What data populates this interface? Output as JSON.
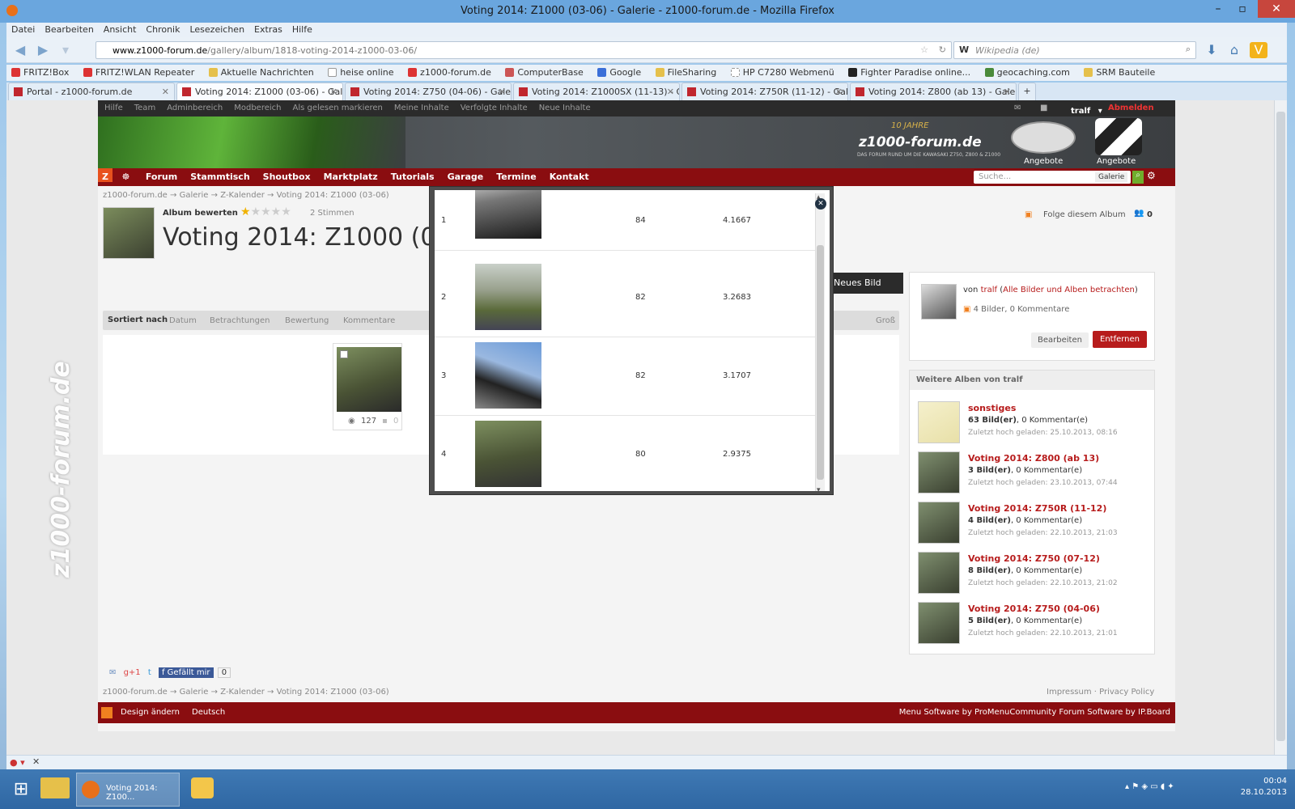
{
  "window": {
    "title": "Voting 2014: Z1000 (03-06) - Galerie - z1000-forum.de - Mozilla Firefox"
  },
  "menu": [
    "Datei",
    "Bearbeiten",
    "Ansicht",
    "Chronik",
    "Lesezeichen",
    "Extras",
    "Hilfe"
  ],
  "url": {
    "domain": "www.z1000-forum.de",
    "path": "/gallery/album/1818-voting-2014-z1000-03-06/"
  },
  "search_placeholder": "Wikipedia (de)",
  "bookmarks": [
    "FRITZ!Box",
    "FRITZ!WLAN Repeater",
    "Aktuelle Nachrichten",
    "heise online",
    "z1000-forum.de",
    "ComputerBase",
    "Google",
    "FileSharing",
    "HP C7280 Webmenü",
    "Fighter Paradise online...",
    "geocaching.com",
    "SRM Bauteile"
  ],
  "tabs": [
    {
      "label": "Portal - z1000-forum.de"
    },
    {
      "label": "Voting 2014: Z1000 (03-06) - Galerie - ..."
    },
    {
      "label": "Voting 2014: Z750 (04-06) - Galerie - z..."
    },
    {
      "label": "Voting 2014: Z1000SX (11-13) - Galeri..."
    },
    {
      "label": "Voting 2014: Z750R (11-12) - Galerie - ..."
    },
    {
      "label": "Voting 2014: Z800 (ab 13) - Galerie - z..."
    }
  ],
  "forum": {
    "topbar": [
      "Hilfe",
      "Team",
      "Adminbereich",
      "Modbereich",
      "Als gelesen markieren",
      "Meine Inhalte",
      "Verfolgte Inhalte",
      "Neue Inhalte"
    ],
    "user": "tralf",
    "logout": "Abmelden",
    "logo_text": "z1000-forum.de",
    "logo_sub": "DAS FORUM RUND UM DIE KAWASAKI Z750, Z800 & Z1000",
    "years": "10 JAHRE",
    "offers1": "Angebote",
    "offers2": "Angebote",
    "nav": [
      "Forum",
      "Stammtisch",
      "Shoutbox",
      "Marktplatz",
      "Tutorials",
      "Garage",
      "Termine",
      "Kontakt"
    ],
    "search_placeholder": "Suche...",
    "search_scope": "Galerie",
    "breadcrumb": [
      "z1000-forum.de",
      "Galerie",
      "Z-Kalender",
      "Voting 2014: Z1000 (03-06)"
    ],
    "rate_label": "Album bewerten",
    "votes": "2 Stimmen",
    "album_title": "Voting 2014: Z1000 (0",
    "follow": "Folge diesem Album",
    "follow_count": "0",
    "new_image": "Neues Bild",
    "sort_label": "Sortiert nach",
    "sort_options": [
      "Datum",
      "Betrachtungen",
      "Bewertung",
      "Kommentare"
    ],
    "size_small": "Groß",
    "thumb_views": "127",
    "thumb_comments": "0",
    "owner_prefix": "von",
    "owner": "tralf",
    "owner_link": "Alle Bilder und Alben betrachten",
    "owner_stats": "4 Bilder, 0 Kommentare",
    "edit": "Bearbeiten",
    "remove": "Entfernen",
    "more_albums_title": "Weitere Alben von tralf",
    "albums": [
      {
        "name": "sonstiges",
        "count": "63 Bild(er)",
        "comments": ", 0 Kommentar(e)",
        "when": "Zuletzt hoch geladen: 25.10.2013, 08:16"
      },
      {
        "name": "Voting 2014: Z800 (ab 13)",
        "count": "3 Bild(er)",
        "comments": ", 0 Kommentar(e)",
        "when": "Zuletzt hoch geladen: 23.10.2013, 07:44"
      },
      {
        "name": "Voting 2014: Z750R (11-12)",
        "count": "4 Bild(er)",
        "comments": ", 0 Kommentar(e)",
        "when": "Zuletzt hoch geladen: 22.10.2013, 21:03"
      },
      {
        "name": "Voting 2014: Z750 (07-12)",
        "count": "8 Bild(er)",
        "comments": ", 0 Kommentar(e)",
        "when": "Zuletzt hoch geladen: 22.10.2013, 21:02"
      },
      {
        "name": "Voting 2014: Z750 (04-06)",
        "count": "5 Bild(er)",
        "comments": ", 0 Kommentar(e)",
        "when": "Zuletzt hoch geladen: 22.10.2013, 21:01"
      }
    ],
    "like": "Gefällt mir",
    "like_count": "0",
    "footer_links": "Impressum · Privacy Policy",
    "design": "Design ändern",
    "language": "Deutsch",
    "credits": "Menu Software by ProMenuCommunity Forum Software by IP.Board"
  },
  "modal": {
    "rows": [
      {
        "rank": "1",
        "views": "84",
        "score": "4.1667"
      },
      {
        "rank": "2",
        "views": "82",
        "score": "3.2683"
      },
      {
        "rank": "3",
        "views": "82",
        "score": "3.1707"
      },
      {
        "rank": "4",
        "views": "80",
        "score": "2.9375"
      }
    ]
  },
  "taskbar": {
    "app_label": "Voting 2014: Z100...",
    "time": "00:04",
    "date": "28.10.2013"
  }
}
